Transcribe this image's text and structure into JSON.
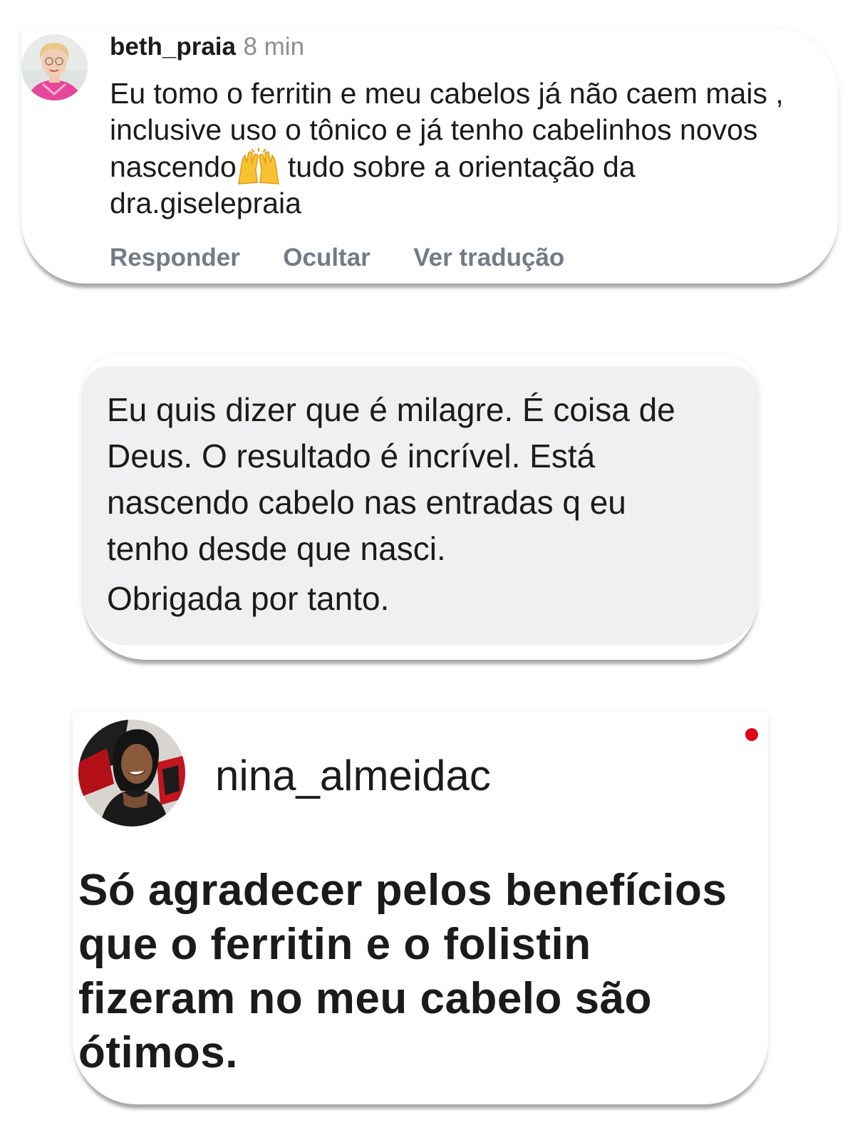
{
  "comment1": {
    "username": "beth_praia",
    "time": "8 min",
    "text_before_emoji": "Eu tomo o ferritin  e meu cabelos já não caem mais , inclusive uso o tônico e já tenho cabelinhos novos nascendo",
    "emoji": "raising-hands-emoji",
    "text_after_emoji": "tudo sobre a orientação da dra.giselepraia",
    "actions": [
      "Responder",
      "Ocultar",
      "Ver tradução"
    ]
  },
  "message2": {
    "lines": [
      "Eu quis dizer que é milagre. É coisa de",
      "Deus. O resultado é incrível. Está",
      "nascendo cabelo nas entradas q eu",
      "tenho desde que nasci.",
      "Obrigada por tanto."
    ]
  },
  "comment3": {
    "username": "nina_almeidac",
    "lines": [
      "Só agradecer pelos benefícios",
      "que o ferritin e o folistin",
      "fizeram no meu cabelo são",
      "ótimos."
    ]
  },
  "colors": {
    "action_gray": "#737b86",
    "time_gray": "#8e8e8e",
    "bubble_gray": "#f0f0f2",
    "notification_red": "#e0001a",
    "emoji_yellow": "#f7c22f"
  }
}
